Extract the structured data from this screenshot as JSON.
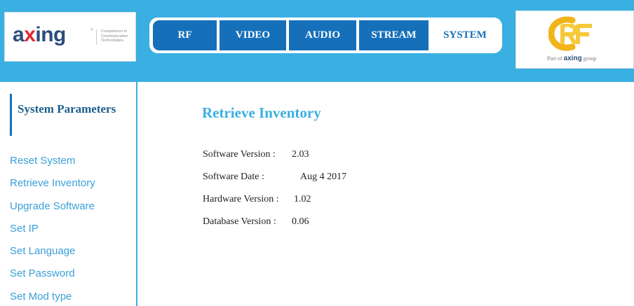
{
  "header": {
    "brand": {
      "name_part1": "a",
      "name_accent": "x",
      "name_part2": "ing",
      "registered": "®",
      "tagline": "Competence in Communication Technologies"
    },
    "nav": {
      "tabs": [
        {
          "label": "RF"
        },
        {
          "label": "VIDEO"
        },
        {
          "label": "AUDIO"
        },
        {
          "label": "STREAM"
        },
        {
          "label": "SYSTEM",
          "active": true
        }
      ]
    },
    "partner_logo": {
      "mark": "RF",
      "caption_prefix": "Part of",
      "caption_brand": "axing",
      "caption_suffix": "group"
    }
  },
  "sidebar": {
    "section_title": "System Parameters",
    "items": [
      {
        "label": "Reset System"
      },
      {
        "label": "Retrieve Inventory"
      },
      {
        "label": "Upgrade Software"
      },
      {
        "label": "Set IP"
      },
      {
        "label": "Set Language"
      },
      {
        "label": "Set Password"
      },
      {
        "label": "Set Mod type"
      }
    ]
  },
  "main": {
    "title": "Retrieve Inventory",
    "rows": [
      {
        "label": "Software Version :",
        "value": "2.03"
      },
      {
        "label": "Software Date :",
        "value": "Aug 4 2017"
      },
      {
        "label": "Hardware Version :",
        "value": "1.02"
      },
      {
        "label": "Database Version :",
        "value": "0.06"
      }
    ]
  },
  "colors": {
    "header_bg": "#3aafe2",
    "tab_bg": "#1670b9",
    "link": "#3aa0d8",
    "section_title": "#1a5e8c",
    "rf_yellow": "#f2b41b"
  },
  "icons": {
    "brand_logo": "axing-logo",
    "partner_logo": "rf-logo"
  }
}
